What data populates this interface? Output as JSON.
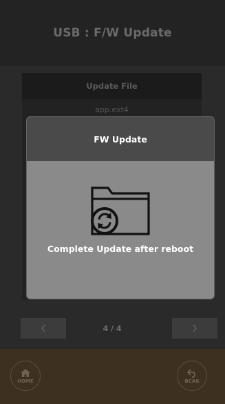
{
  "header": {
    "title": "USB : F/W Update"
  },
  "file_list": {
    "header": "Update File",
    "items": [
      "app.ext4"
    ]
  },
  "pagination": {
    "prev_icon": "chevron-left-icon",
    "next_icon": "chevron-right-icon",
    "indicator": "4 / 4"
  },
  "bottom_bar": {
    "home_label": "HOME",
    "back_label": "BCAK",
    "home_icon": "home-icon",
    "back_icon": "back-arrow-icon"
  },
  "dialog": {
    "title": "FW Update",
    "icon": "folder-sync-icon",
    "message": "Complete Update after reboot"
  },
  "colors": {
    "background": "#2a2a2a",
    "dialog_body": "#8a8a8a",
    "dialog_header": "#4a4a4a",
    "bottom_bar": "#3d3020"
  }
}
